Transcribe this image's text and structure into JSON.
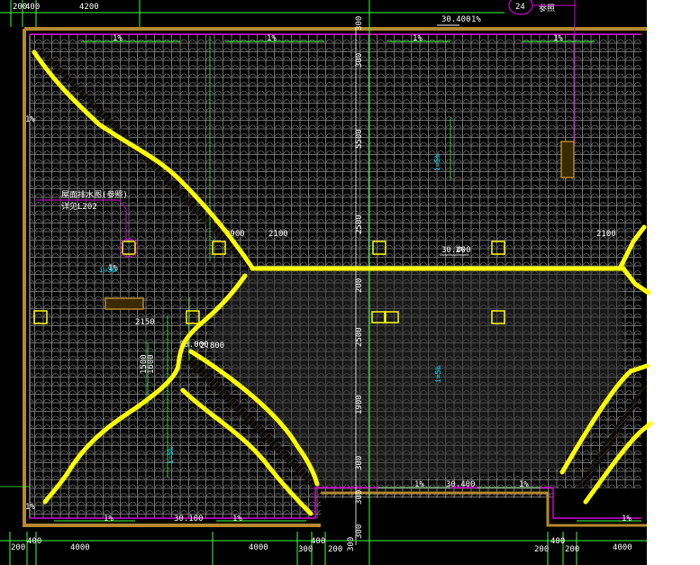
{
  "colors": {
    "background": "#000000",
    "grid": "#9a9a9a",
    "boundary_magenta": "#d400d4",
    "parapet_brown": "#b5892e",
    "axis_green": "#3cff3c",
    "markup_yellow": "#ffff00",
    "annotation_cyan": "#00e5ff"
  },
  "top_dims": {
    "d1": "200",
    "d2": "400",
    "d3": "4200",
    "elev_top": "30.400",
    "slope_top": "1%",
    "callout_num": "24",
    "callout_text": "参照"
  },
  "slopes": {
    "s1": "1%",
    "s2": "1%",
    "s3": "1%",
    "s4": "1%",
    "s5": "1%",
    "s6": "1%",
    "s7": "1%",
    "s8": "1%",
    "s9": "1%",
    "s10": "1%",
    "s11": "1%",
    "s12": "1%"
  },
  "vertical_dims": {
    "v1": "300",
    "v2": "300",
    "v3": "5500",
    "v4": "2500",
    "v5": "200",
    "v6": "2500",
    "v7": "1900",
    "v8": "300",
    "v9": "300",
    "v10": "300"
  },
  "elevations": {
    "e1": "30.400",
    "e2": "30.100",
    "e3": "30.400",
    "e4": "30.000",
    "e5": "i=5‰",
    "e6": "i=5‰",
    "e7": "i=5‰"
  },
  "misc_labels": {
    "note1": "屋面排水图(参照)",
    "note2": "详见L202",
    "l1": "2900",
    "l2": "2100",
    "l3": "2100",
    "l4": "2150",
    "l5": "1500",
    "l6": "2.800",
    "l7": "1600",
    "l8": "1%",
    "l9": "i=5‰"
  },
  "bottom_dims": {
    "b1": "200",
    "b2": "400",
    "b3": "4000",
    "b4": "4000",
    "b5": "300",
    "b6": "400",
    "b7": "200",
    "b8": "200",
    "b9": "400",
    "b10": "200",
    "b11": "4000"
  }
}
